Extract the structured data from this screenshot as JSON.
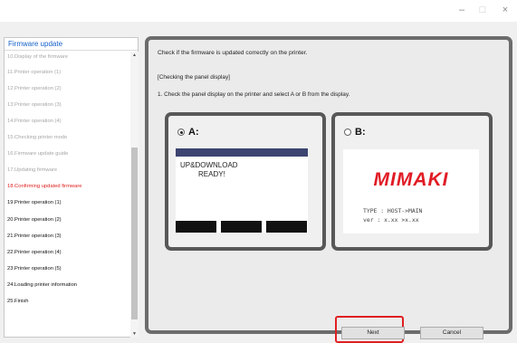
{
  "window": {
    "controls": {
      "minimize": "–",
      "maximize": "□",
      "close": "×"
    }
  },
  "sidebar": {
    "header": "Firmware update",
    "items": [
      {
        "label": "10.Display of the firmware",
        "state": "done"
      },
      {
        "label": "11.Printer operation (1)",
        "state": "done"
      },
      {
        "label": "12.Printer operation (2)",
        "state": "done"
      },
      {
        "label": "13.Printer operation (3)",
        "state": "done"
      },
      {
        "label": "14.Printer operation (4)",
        "state": "done"
      },
      {
        "label": "15.Checking printer mode",
        "state": "done"
      },
      {
        "label": "16.Firmware update guide",
        "state": "done"
      },
      {
        "label": "17.Updating firmware",
        "state": "done"
      },
      {
        "label": "18.Confirming updated firmware",
        "state": "current"
      },
      {
        "label": "19.Printer operation (1)",
        "state": "pending"
      },
      {
        "label": "20.Printer operation (2)",
        "state": "pending"
      },
      {
        "label": "21.Printer operation (3)",
        "state": "pending"
      },
      {
        "label": "22.Printer operation (4)",
        "state": "pending"
      },
      {
        "label": "23.Printer operation (5)",
        "state": "pending"
      },
      {
        "label": "24.Loading printer information",
        "state": "pending"
      },
      {
        "label": "25.Finish",
        "state": "pending"
      }
    ],
    "scroll_up": "▲",
    "scroll_down": "▼"
  },
  "main": {
    "instruction": "Check if the firmware is updated correctly on the printer.",
    "section": "[Checking the panel display]",
    "step": "1.  Check the panel display on the printer and select A or B from the display."
  },
  "option_a": {
    "label": "A:",
    "selected": true,
    "display_line1": "UP&DOWNLOAD",
    "display_line2": "READY!"
  },
  "option_b": {
    "label": "B:",
    "selected": false,
    "brand": "MIMAKI",
    "line1": "TYPE : HOST->MAIN",
    "line2": "ver  : x.xx >x.xx"
  },
  "buttons": {
    "next": "Next",
    "cancel": "Cancel"
  },
  "colors": {
    "accent_blue": "#1560c9",
    "current_step_red": "#e02020",
    "highlight_red": "#e02020",
    "brand_red": "#e01c24",
    "lcd_header": "#3c4470"
  }
}
